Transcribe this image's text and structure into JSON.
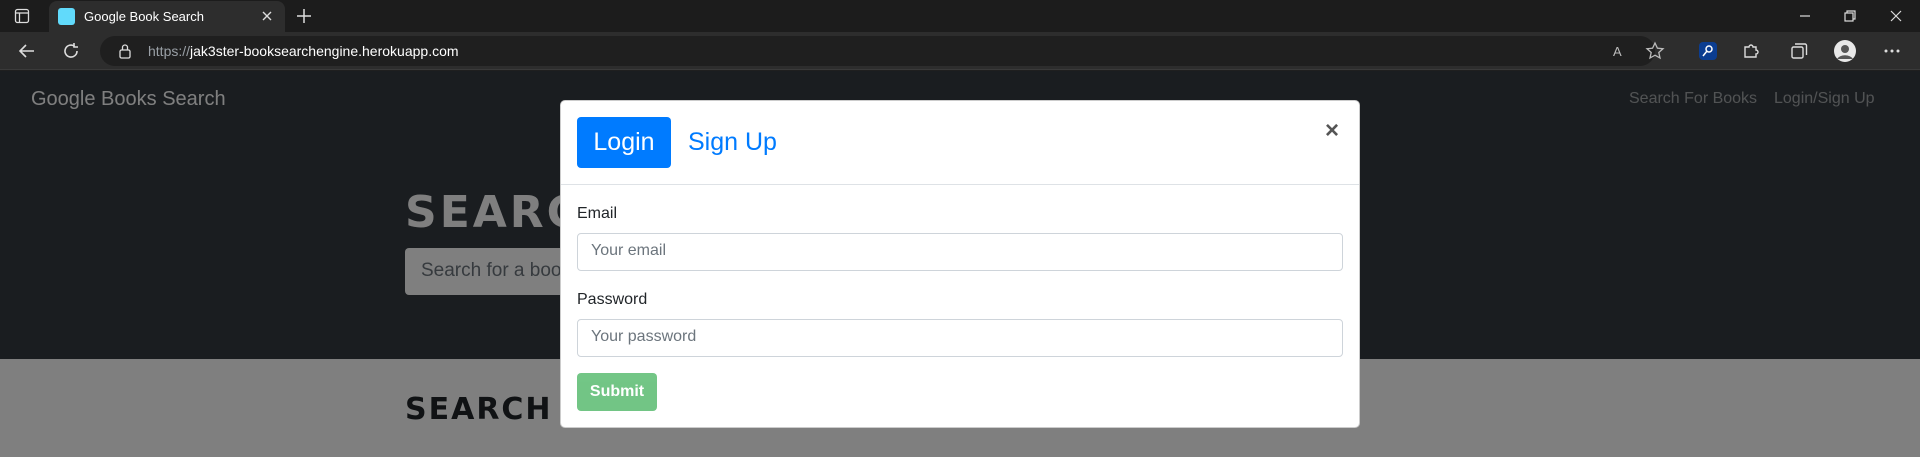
{
  "browser": {
    "tab_title": "Google Book Search",
    "url_protocol": "https://",
    "url_host": "jak3ster-booksearchengine.herokuapp.com",
    "colors": {
      "chrome_bg": "#1c1c1c",
      "toolbar_bg": "#2d2d2d",
      "accent": "#61dafb"
    }
  },
  "navbar": {
    "brand": "Google Books Search",
    "links": [
      "Search For Books",
      "Login/Sign Up"
    ]
  },
  "hero": {
    "title": "SEARCH FOR BOOKS!",
    "search_placeholder": "Search for a book"
  },
  "results": {
    "title": "SEARCH FOR A BOOK TO BEGIN"
  },
  "modal": {
    "tabs": [
      {
        "label": "Login",
        "active": true
      },
      {
        "label": "Sign Up",
        "active": false
      }
    ],
    "close_glyph": "×",
    "email_label": "Email",
    "email_placeholder": "Your email",
    "password_label": "Password",
    "password_placeholder": "Your password",
    "submit_label": "Submit",
    "colors": {
      "primary": "#007bff",
      "success": "#28a745"
    }
  }
}
